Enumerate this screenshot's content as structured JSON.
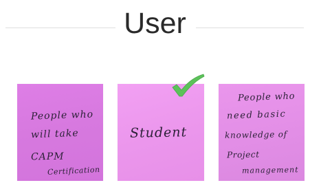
{
  "header": {
    "title": "User"
  },
  "notes": [
    {
      "lines": [
        "People who",
        "will take",
        "CAPM",
        "Certification"
      ]
    },
    {
      "lines": [
        "Student"
      ],
      "mark": "check-icon"
    },
    {
      "lines": [
        "People who",
        "need basic",
        "knowledge of",
        "Project",
        "management"
      ]
    }
  ],
  "colors": {
    "note_1": "#d97be1",
    "note_2": "#ee9aef",
    "note_3": "#e391e6",
    "check": "#5cc25a",
    "ink": "#2d2138"
  }
}
